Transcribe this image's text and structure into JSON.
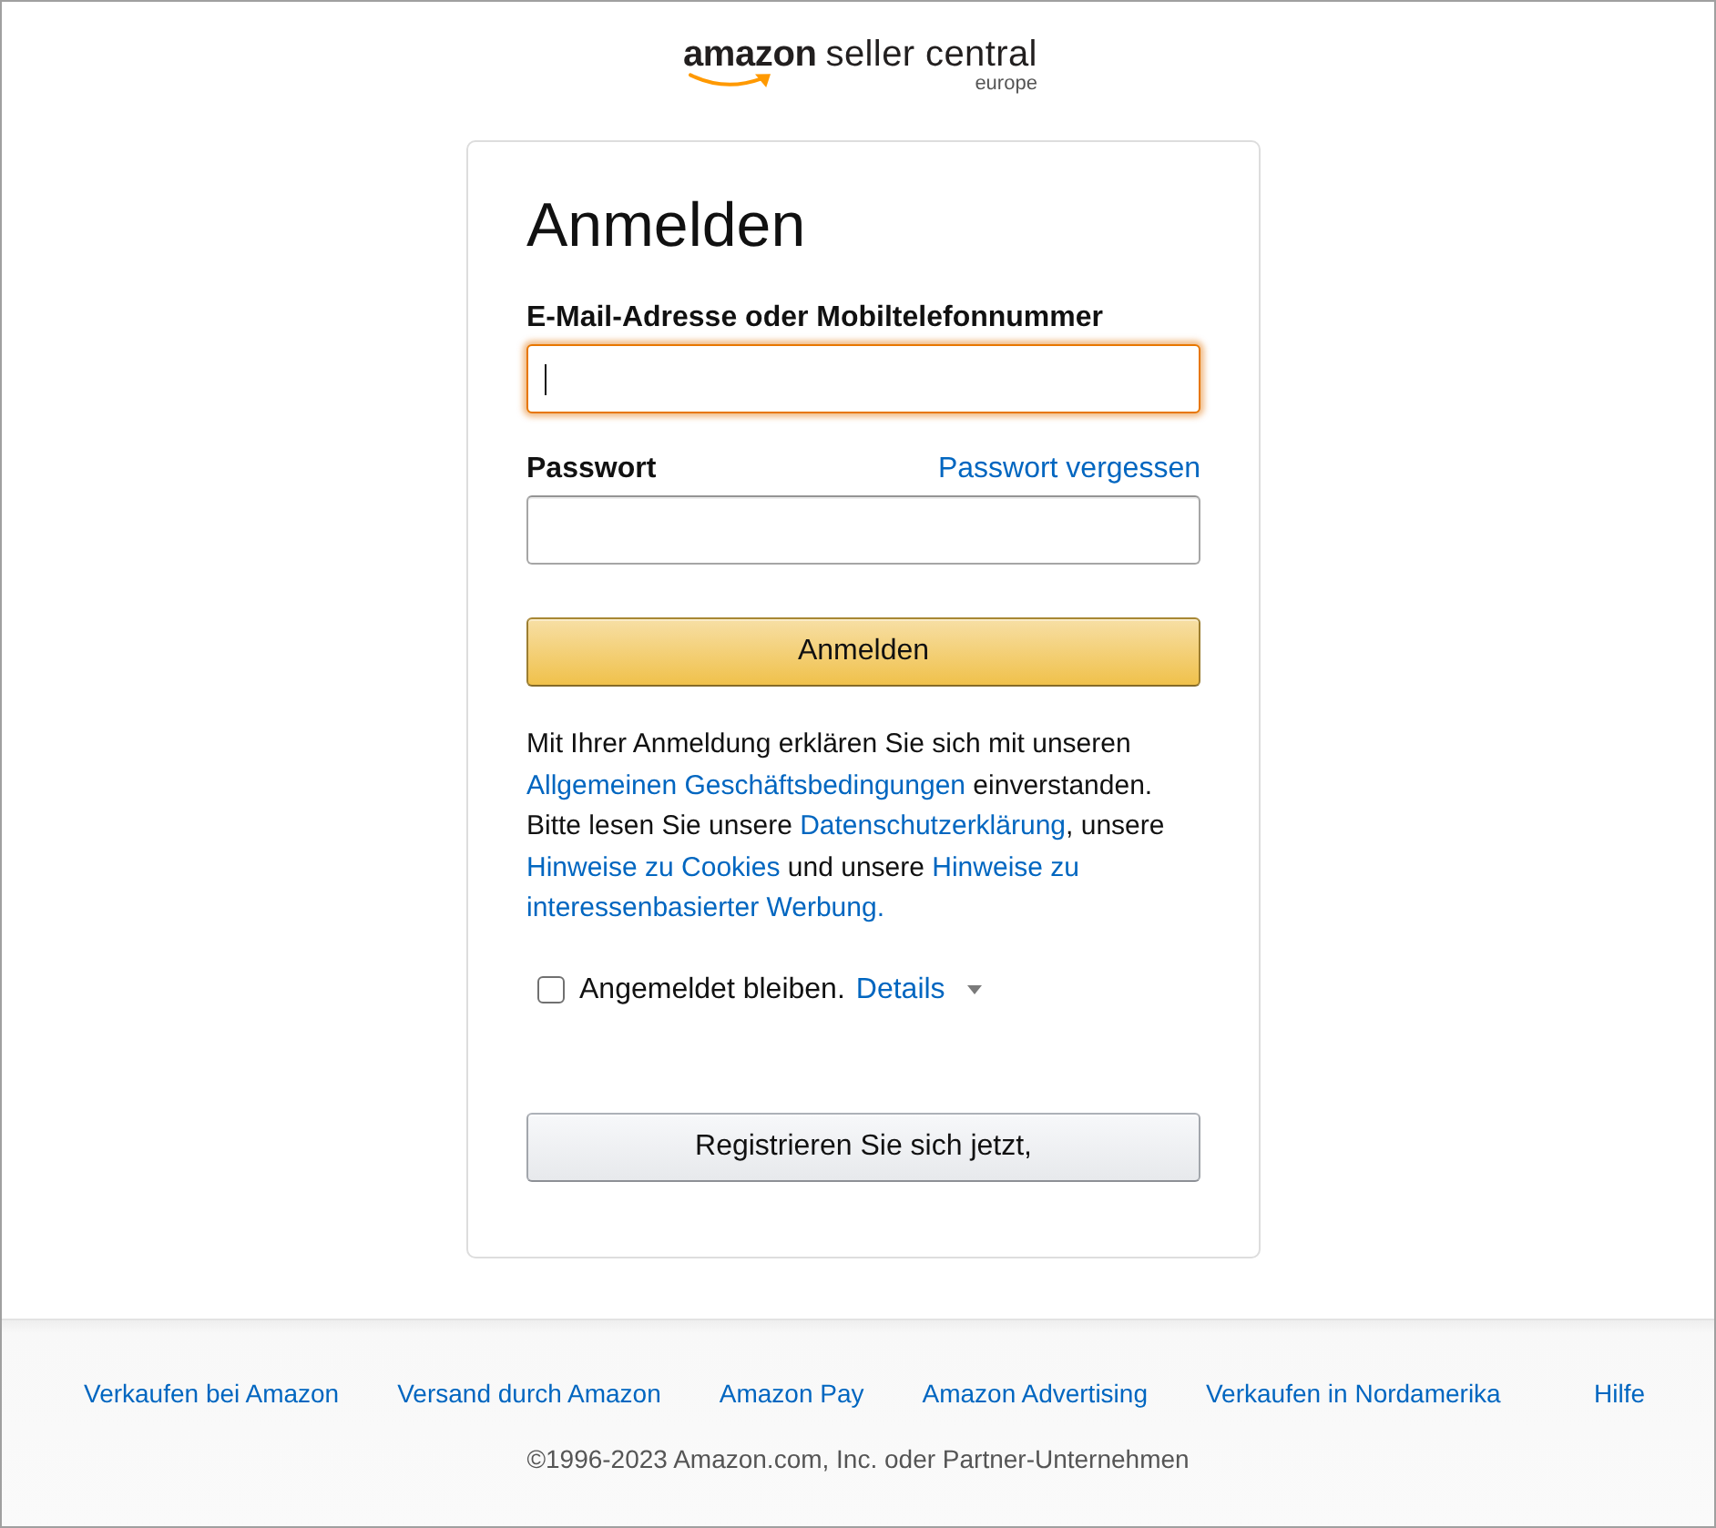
{
  "logo": {
    "brand": "amazon",
    "product": "seller central",
    "region": "europe"
  },
  "signin": {
    "title": "Anmelden",
    "fields": [
      {
        "label": "E-Mail-Adresse oder Mobiltelefonnummer",
        "focused": true
      },
      {
        "label": "Passwort",
        "link": "Passwort vergessen",
        "focused": false
      }
    ],
    "submit_button": "Anmelden",
    "legal_notice": [
      {
        "kind": "text",
        "text": "Mit Ihrer Anmeldung erklären Sie sich mit unseren "
      },
      {
        "kind": "link",
        "text": "Allgemeinen Geschäftsbedingungen"
      },
      {
        "kind": "text",
        "text": " einverstanden. Bitte lesen Sie unsere "
      },
      {
        "kind": "link",
        "text": "Datenschutzerklärung"
      },
      {
        "kind": "text",
        "text": ", unsere "
      },
      {
        "kind": "link",
        "text": "Hinweise zu Cookies"
      },
      {
        "kind": "text",
        "text": " und unsere "
      },
      {
        "kind": "link",
        "text": "Hinweise zu"
      },
      {
        "kind": "link",
        "text": "interessenbasierter Werbung."
      }
    ],
    "remember_me": {
      "label": "Angemeldet bleiben.",
      "checked": false,
      "details_link": "Details"
    },
    "register_button": "Registrieren Sie sich jetzt,"
  },
  "footer": {
    "links": [
      "Verkaufen bei Amazon",
      "Versand durch Amazon",
      "Amazon Pay",
      "Amazon Advertising",
      "Verkaufen in Nordamerika",
      "Hilfe"
    ],
    "copyright": "©1996-2023 Amazon.com, Inc. oder Partner-Unternehmen"
  }
}
